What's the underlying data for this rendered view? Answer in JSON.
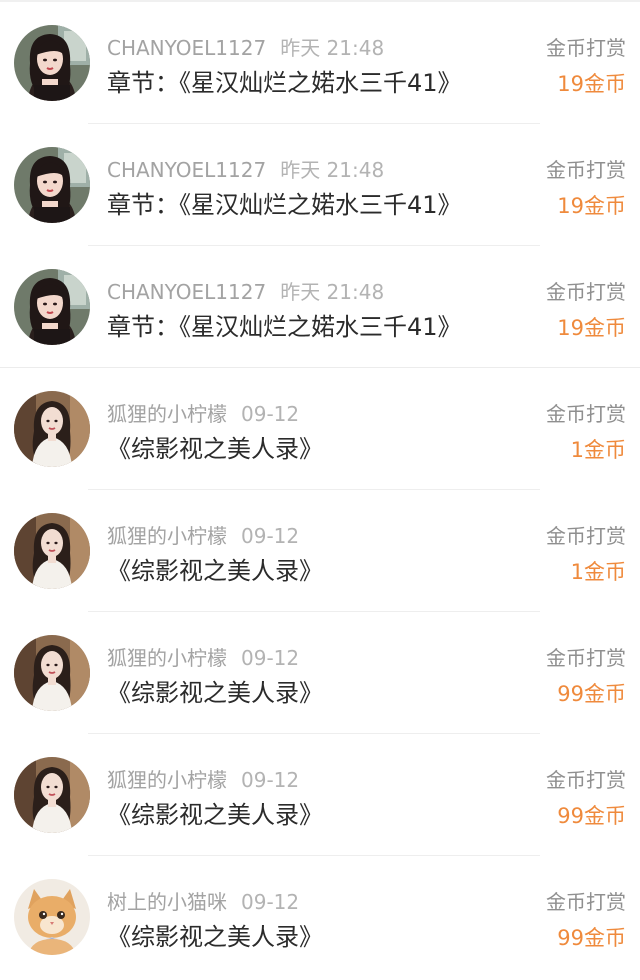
{
  "rows": [
    {
      "user": "CHANYOEL1127",
      "time": "昨天 21:48",
      "title": "章节：《星汉灿烂之婼水三千41》",
      "type": "金币打赏",
      "amount": "19金币",
      "avatar": "girl-dark-hair-icon"
    },
    {
      "user": "CHANYOEL1127",
      "time": "昨天 21:48",
      "title": "章节：《星汉灿烂之婼水三千41》",
      "type": "金币打赏",
      "amount": "19金币",
      "avatar": "girl-dark-hair-icon"
    },
    {
      "user": "CHANYOEL1127",
      "time": "昨天 21:48",
      "title": "章节：《星汉灿烂之婼水三千41》",
      "type": "金币打赏",
      "amount": "19金币",
      "avatar": "girl-dark-hair-icon"
    },
    {
      "user": "狐狸的小柠檬",
      "time": "09-12",
      "title": "《综影视之美人录》",
      "type": "金币打赏",
      "amount": "1金币",
      "avatar": "girl-white-dress-icon"
    },
    {
      "user": "狐狸的小柠檬",
      "time": "09-12",
      "title": "《综影视之美人录》",
      "type": "金币打赏",
      "amount": "1金币",
      "avatar": "girl-white-dress-icon"
    },
    {
      "user": "狐狸的小柠檬",
      "time": "09-12",
      "title": "《综影视之美人录》",
      "type": "金币打赏",
      "amount": "99金币",
      "avatar": "girl-white-dress-icon"
    },
    {
      "user": "狐狸的小柠檬",
      "time": "09-12",
      "title": "《综影视之美人录》",
      "type": "金币打赏",
      "amount": "99金币",
      "avatar": "girl-white-dress-icon"
    },
    {
      "user": "树上的小猫咪",
      "time": "09-12",
      "title": "《综影视之美人录》",
      "type": "金币打赏",
      "amount": "99金币",
      "avatar": "orange-cat-icon"
    }
  ],
  "colors": {
    "amount": "#ef8a3c",
    "title": "#2b2b2b",
    "meta": "#a3a3a3"
  }
}
